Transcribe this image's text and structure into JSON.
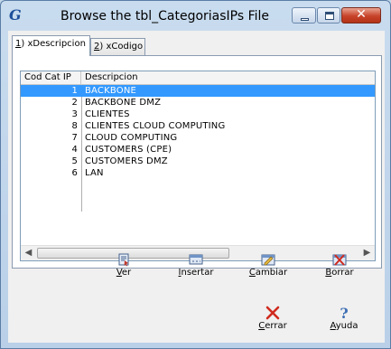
{
  "window": {
    "title": "Browse the tbl_CategoriasIPs File",
    "close_glyph": "✕"
  },
  "tabs": [
    {
      "key": "1",
      "rest": ") xDescripcion"
    },
    {
      "key": "2",
      "rest": ") xCodigo"
    }
  ],
  "table": {
    "columns": [
      "Cod Cat IP",
      "Descripcion"
    ],
    "rows": [
      {
        "code": "1",
        "desc": "BACKBONE",
        "selected": true
      },
      {
        "code": "2",
        "desc": "BACKBONE DMZ"
      },
      {
        "code": "3",
        "desc": "CLIENTES"
      },
      {
        "code": "8",
        "desc": "CLIENTES CLOUD COMPUTING"
      },
      {
        "code": "7",
        "desc": "CLOUD COMPUTING"
      },
      {
        "code": "4",
        "desc": "CUSTOMERS (CPE)"
      },
      {
        "code": "5",
        "desc": "CUSTOMERS DMZ"
      },
      {
        "code": "6",
        "desc": "LAN"
      }
    ]
  },
  "actions": {
    "ver": {
      "key": "V",
      "rest": "er",
      "icon": "view-icon"
    },
    "insertar": {
      "key": "I",
      "rest": "nsertar",
      "icon": "insert-icon"
    },
    "cambiar": {
      "key": "C",
      "rest": "ambiar",
      "icon": "edit-icon"
    },
    "borrar": {
      "key": "B",
      "rest": "orrar",
      "icon": "delete-icon"
    },
    "cerrar": {
      "key": "C",
      "rest": "errar",
      "icon": "close-x-icon"
    },
    "ayuda": {
      "key": "A",
      "rest": "yuda",
      "icon": "help-icon"
    }
  },
  "colors": {
    "selection": "#3399ff",
    "accent": "#1d4f9a",
    "close_button": "#c8432a"
  }
}
